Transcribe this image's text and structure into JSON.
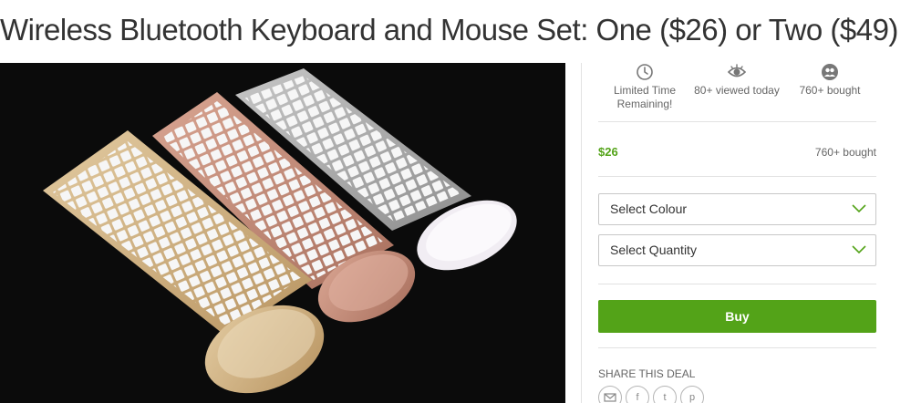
{
  "deal": {
    "title": "Wireless Bluetooth Keyboard and Mouse Set: One ($26) or Two ($49)"
  },
  "stats": [
    {
      "icon": "clock-icon",
      "text": "Limited Time Remaining!"
    },
    {
      "icon": "eye-icon",
      "text": "80+ viewed today"
    },
    {
      "icon": "people-icon",
      "text": "760+ bought"
    }
  ],
  "pricing": {
    "price": "$26",
    "bought": "760+ bought"
  },
  "options": {
    "colour_label": "Select Colour",
    "quantity_label": "Select Quantity"
  },
  "actions": {
    "buy_label": "Buy"
  },
  "share": {
    "label": "SHARE THIS DEAL",
    "icons": [
      "email-icon",
      "facebook-icon",
      "twitter-icon",
      "pinterest-icon"
    ],
    "glyphs": [
      "f",
      "t",
      "p"
    ]
  },
  "colors": {
    "accent": "#53a318",
    "text": "#333333",
    "muted": "#666666",
    "border": "#e2e2e2"
  }
}
